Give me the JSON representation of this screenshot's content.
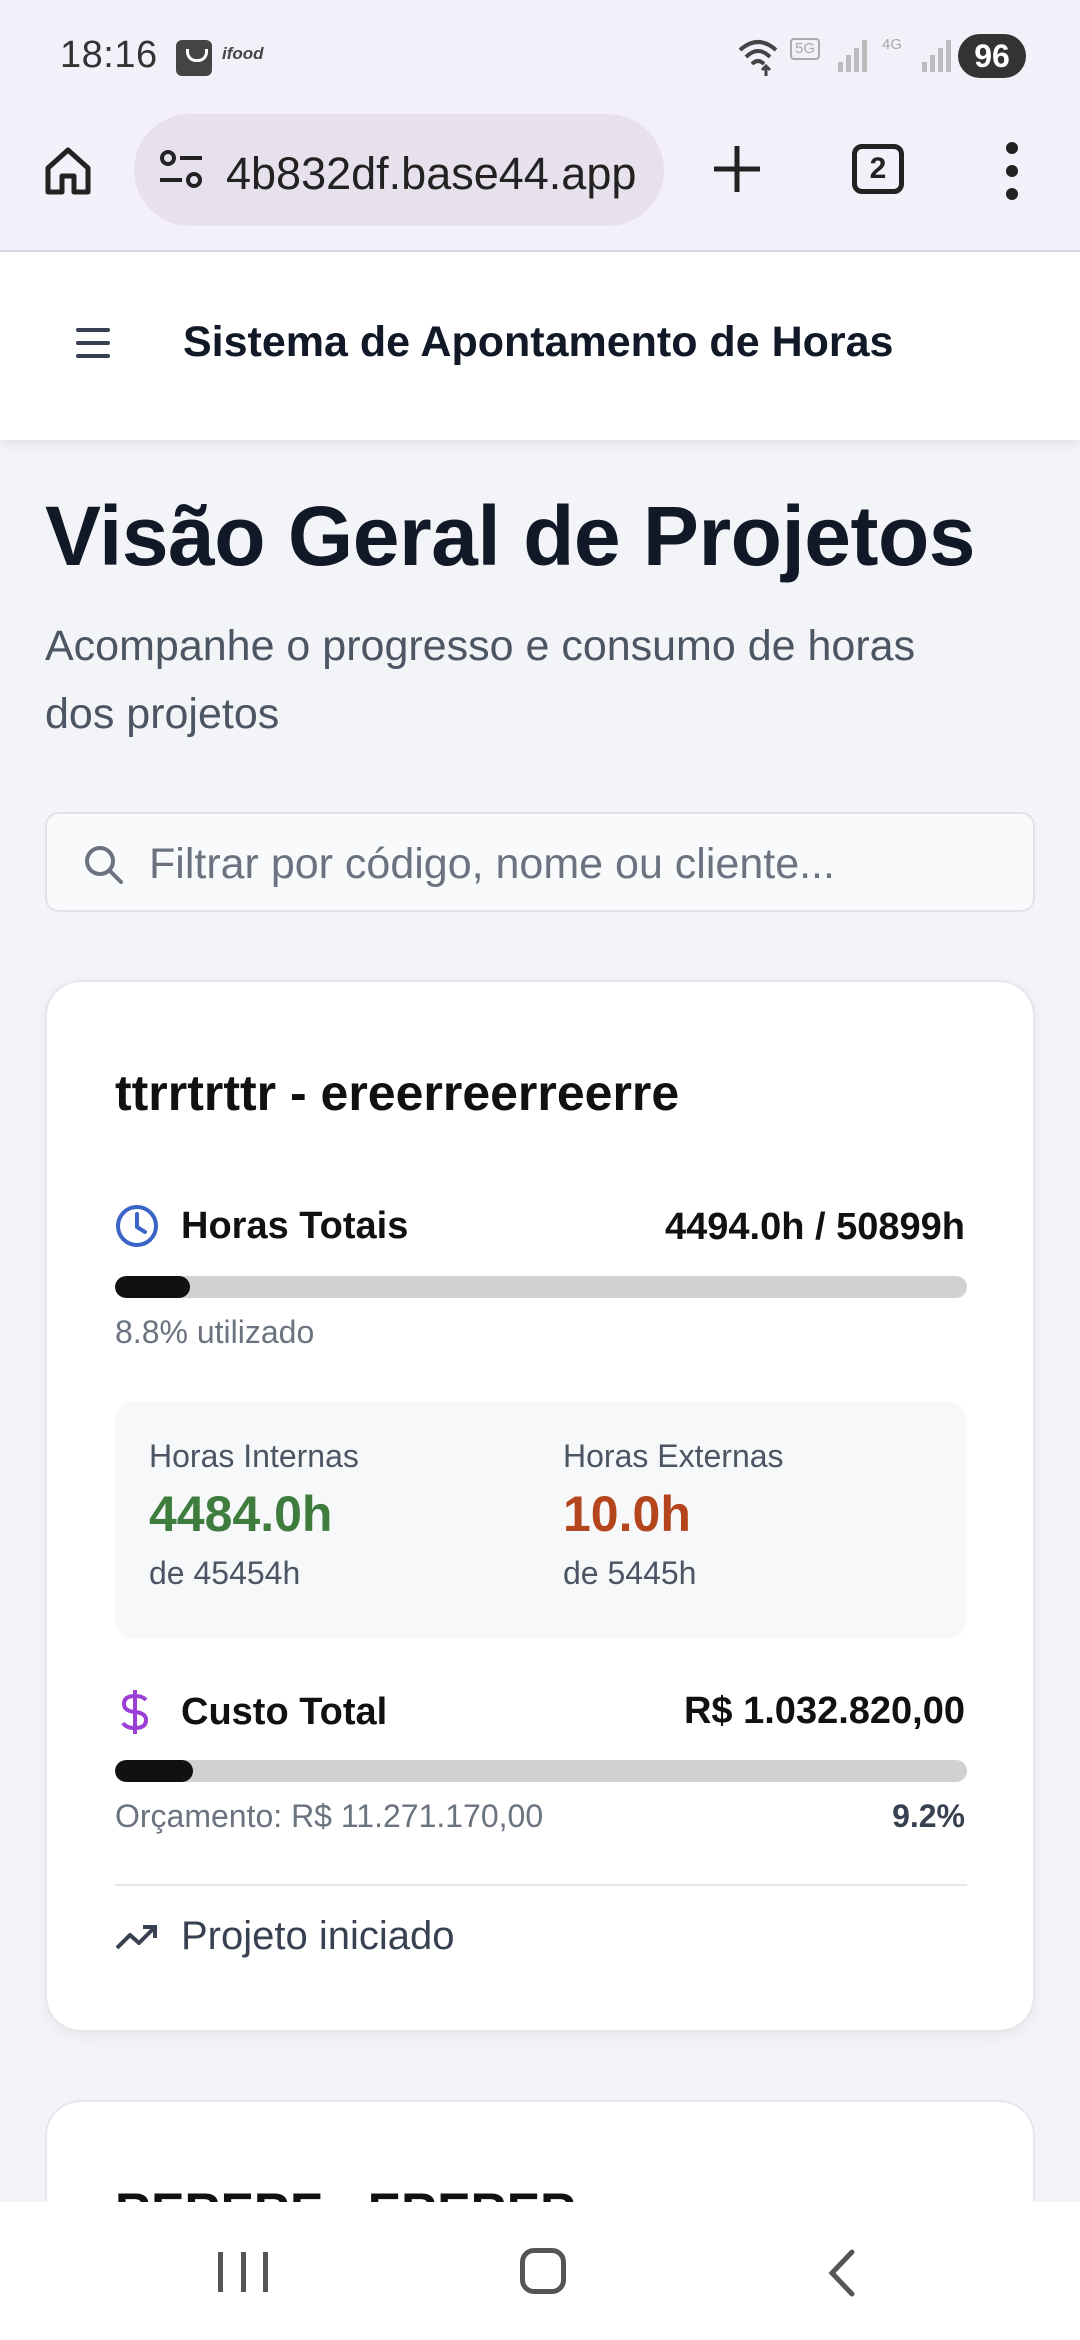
{
  "status_bar": {
    "time": "18:16",
    "app_badge_text": "ifood",
    "network_5g": "5G",
    "network_4g": "4G",
    "battery": "96"
  },
  "browser": {
    "url": "4b832df.base44.app",
    "tab_count": "2"
  },
  "header": {
    "title": "Sistema de Apontamento de Horas"
  },
  "page": {
    "title": "Visão Geral de Projetos",
    "subtitle": "Acompanhe o progresso e consumo de horas dos projetos"
  },
  "search": {
    "placeholder": "Filtrar por código, nome ou cliente...",
    "value": ""
  },
  "projects": [
    {
      "title": "ttrrtrttr - ereerreerreerre",
      "total_hours_label": "Horas Totais",
      "total_hours_value": "4494.0h / 50899h",
      "hours_progress": 0.088,
      "hours_used_text": "8.8% utilizado",
      "internal_label": "Horas Internas",
      "internal_value": "4484.0h",
      "internal_sub": "de 45454h",
      "external_label": "Horas Externas",
      "external_value": "10.0h",
      "external_sub": "de 5445h",
      "cost_label": "Custo Total",
      "cost_value": "R$ 1.032.820,00",
      "cost_progress": 0.092,
      "budget_text": "Orçamento: R$ 11.271.170,00",
      "budget_percent": "9.2%",
      "status_text": "Projeto iniciado"
    },
    {
      "title": "RERERE - ERERER"
    }
  ],
  "colors": {
    "internal_green": "#3f7d3e",
    "external_orange": "#b4451d",
    "clock_blue": "#3b64c8",
    "dollar_purple": "#9b3fd6"
  }
}
